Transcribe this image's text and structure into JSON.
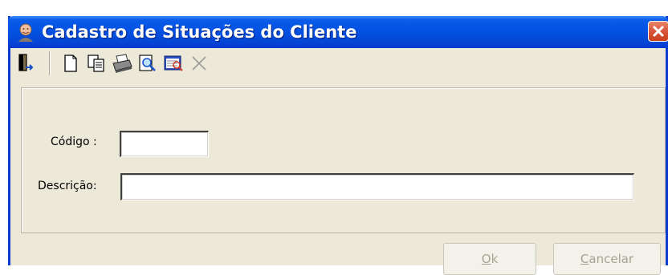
{
  "window": {
    "title": "Cadastro de Situações do Cliente",
    "title_bar_color": "#0452E4",
    "close_button_color": "#D8553A"
  },
  "toolbar": {
    "items": [
      {
        "name": "exit-door-icon",
        "enabled": true
      },
      {
        "name": "new-document-icon",
        "enabled": true
      },
      {
        "name": "copy-icon",
        "enabled": true
      },
      {
        "name": "printer-icon",
        "enabled": true
      },
      {
        "name": "magnifier-icon",
        "enabled": true
      },
      {
        "name": "search-list-icon",
        "enabled": true
      },
      {
        "name": "delete-x-icon",
        "enabled": false
      }
    ]
  },
  "form": {
    "codigo_label": "Código :",
    "codigo_value": "",
    "descricao_label": "Descrição:",
    "descricao_value": ""
  },
  "buttons": {
    "ok_mnemonic": "O",
    "ok_rest": "k",
    "cancel_mnemonic": "C",
    "cancel_rest": "ancelar",
    "disabled_text_color": "#A7A392"
  },
  "colors": {
    "window_face": "#ECE9D8",
    "border_blue": "#0839D1"
  }
}
